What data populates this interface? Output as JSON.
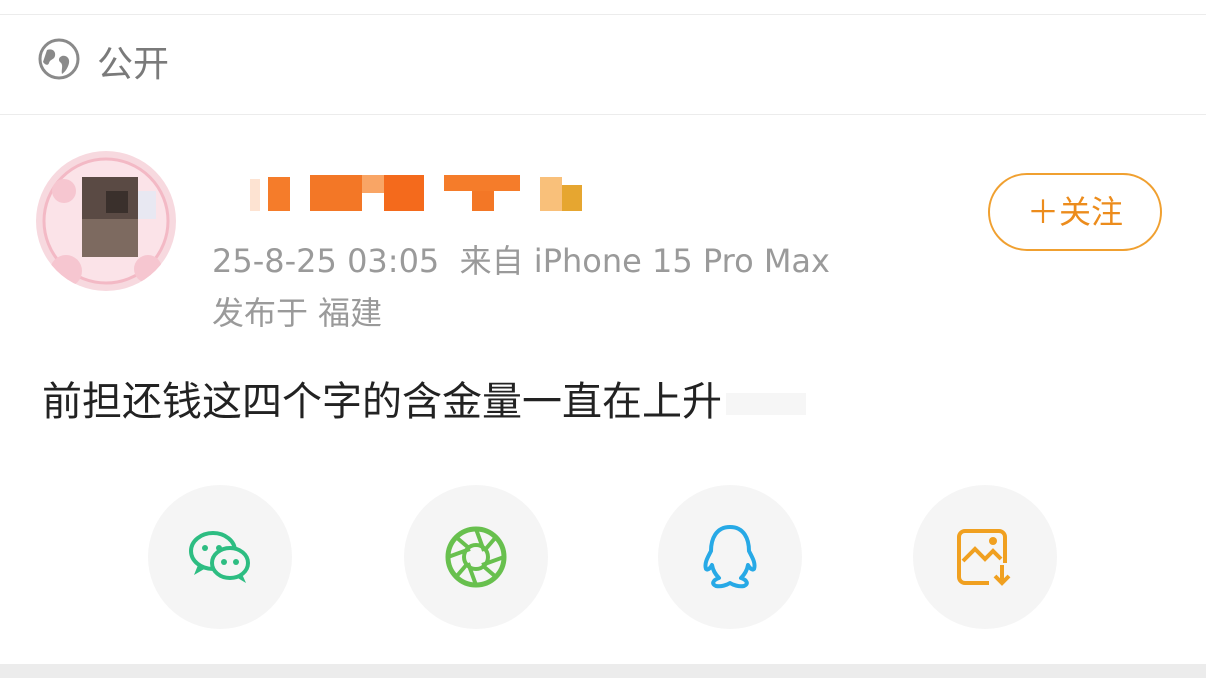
{
  "visibility": {
    "label": "公开",
    "icon": "globe-icon"
  },
  "post": {
    "author_name_visible": false,
    "timestamp": "25-8-25 03:05",
    "source": "来自 iPhone 15 Pro Max",
    "location": "发布于 福建",
    "text": "前担还钱这四个字的含金量一直在上升"
  },
  "follow": {
    "label": "＋关注"
  },
  "share": {
    "items": [
      {
        "name": "wechat",
        "icon": "wechat-icon",
        "color": "#2dbd82"
      },
      {
        "name": "moments",
        "icon": "moments-icon",
        "color": "#68c04e"
      },
      {
        "name": "qq",
        "icon": "qq-icon",
        "color": "#27a9e6"
      },
      {
        "name": "save-image",
        "icon": "save-image-icon",
        "color": "#f0a020"
      }
    ]
  },
  "colors": {
    "accent": "#ec8c1c",
    "text_primary": "#222222",
    "text_secondary": "#9a9a9a"
  }
}
